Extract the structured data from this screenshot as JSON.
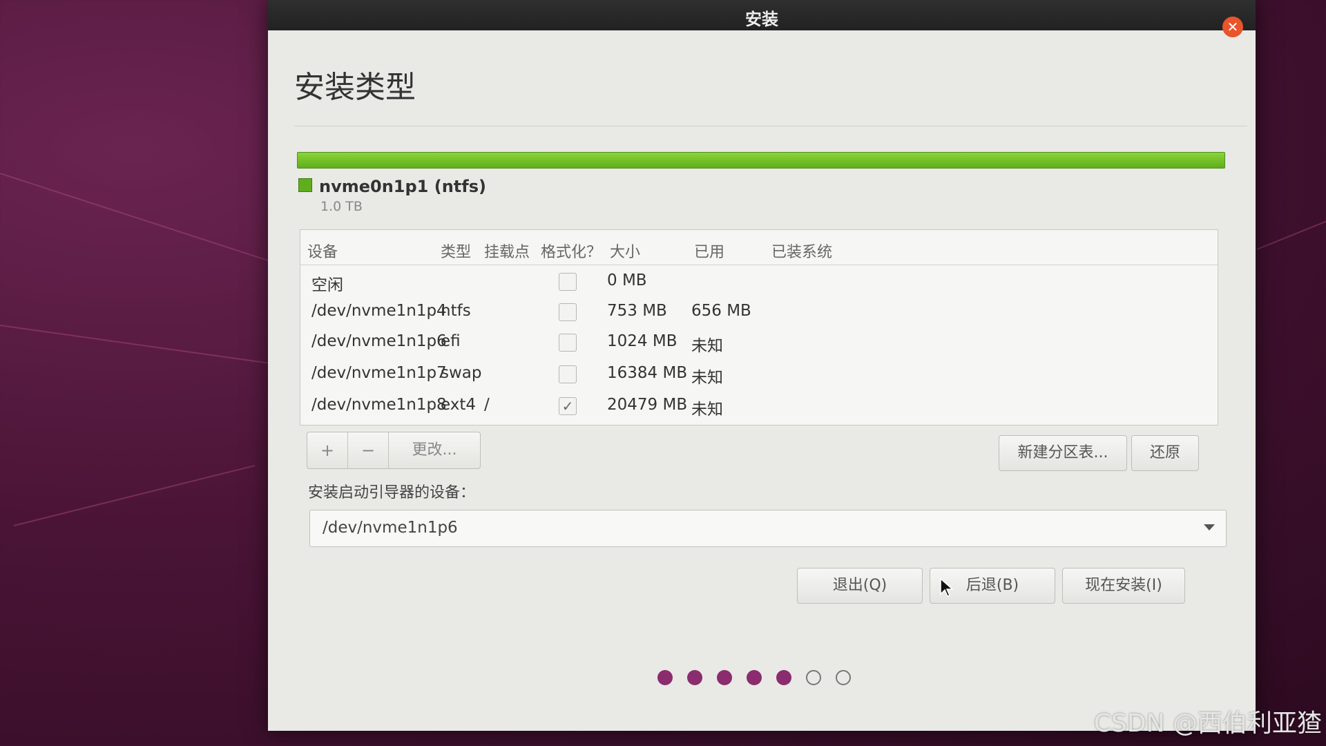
{
  "window": {
    "title": "安装"
  },
  "page": {
    "title": "安装类型"
  },
  "disk": {
    "name": "nvme0n1p1 (ntfs)",
    "size": "1.0 TB",
    "bar_color": "#6cbf26"
  },
  "table": {
    "headers": [
      "设备",
      "类型",
      "挂载点",
      "格式化？",
      "大小",
      "已用",
      "已装系统"
    ],
    "rows": [
      {
        "device": "空闲",
        "type": "",
        "mount": "",
        "format": false,
        "size": "0 MB",
        "used": "",
        "system": ""
      },
      {
        "device": "/dev/nvme1n1p4",
        "type": "ntfs",
        "mount": "",
        "format": false,
        "size": "753 MB",
        "used": "656 MB",
        "system": ""
      },
      {
        "device": "/dev/nvme1n1p6",
        "type": "efi",
        "mount": "",
        "format": false,
        "size": "1024 MB",
        "used": "未知",
        "system": ""
      },
      {
        "device": "/dev/nvme1n1p7",
        "type": "swap",
        "mount": "",
        "format": false,
        "size": "16384 MB",
        "used": "未知",
        "system": ""
      },
      {
        "device": "/dev/nvme1n1p8",
        "type": "ext4",
        "mount": "/",
        "format": true,
        "size": "20479 MB",
        "used": "未知",
        "system": ""
      }
    ]
  },
  "partition_buttons": {
    "add": "+",
    "remove": "−",
    "change": "更改..."
  },
  "new_table_button": "新建分区表...",
  "revert_button": "还原",
  "bootloader": {
    "label": "安装启动引导器的设备：",
    "value": "/dev/nvme1n1p6"
  },
  "nav": {
    "quit": "退出(Q)",
    "back": "后退(B)",
    "install": "现在安装(I)"
  },
  "progress": {
    "filled": 5,
    "total": 7,
    "color": "#8a2c6e"
  },
  "watermark": "CSDN @西伯利亚猹"
}
